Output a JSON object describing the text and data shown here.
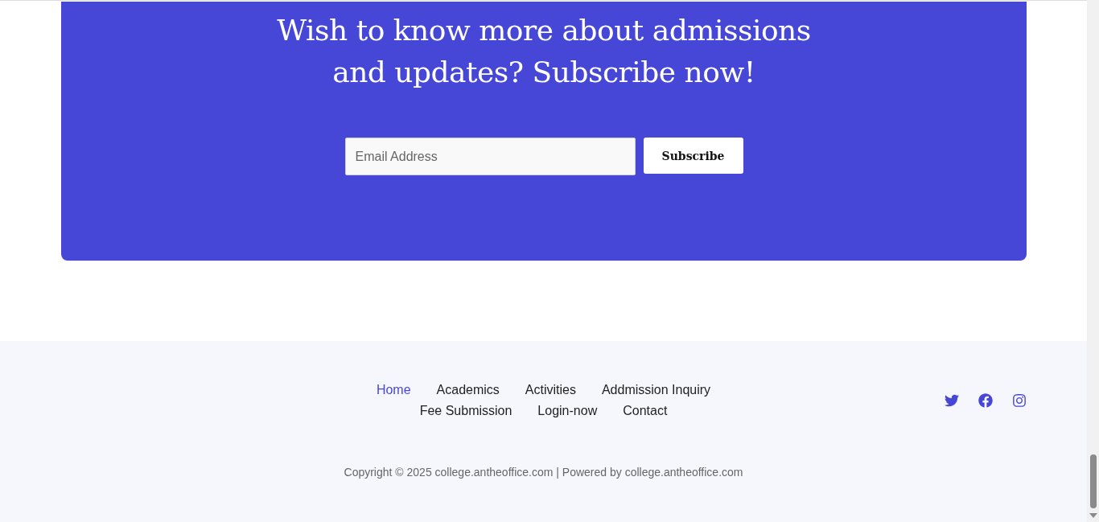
{
  "subscribe": {
    "heading_lines": [
      "Wish to know more about admissions",
      "and updates? Subscribe now!"
    ],
    "email": {
      "placeholder": "Email Address"
    },
    "button": "Subscribe"
  },
  "footer": {
    "nav_rows": [
      [
        {
          "label": "Home",
          "selected": true
        },
        {
          "label": "Academics",
          "selected": false
        },
        {
          "label": "Activities",
          "selected": false
        },
        {
          "label": "Addmission Inquiry",
          "selected": false
        }
      ],
      [
        {
          "label": "Fee Submission",
          "selected": false
        },
        {
          "label": "Login-now",
          "selected": false
        },
        {
          "label": "Contact",
          "selected": false
        }
      ]
    ],
    "social": [
      {
        "kind": "twitter"
      },
      {
        "kind": "facebook"
      },
      {
        "kind": "instagram"
      }
    ],
    "copyright": "Copyright © 2025 college.antheoffice.com | Powered by college.antheoffice.com"
  }
}
